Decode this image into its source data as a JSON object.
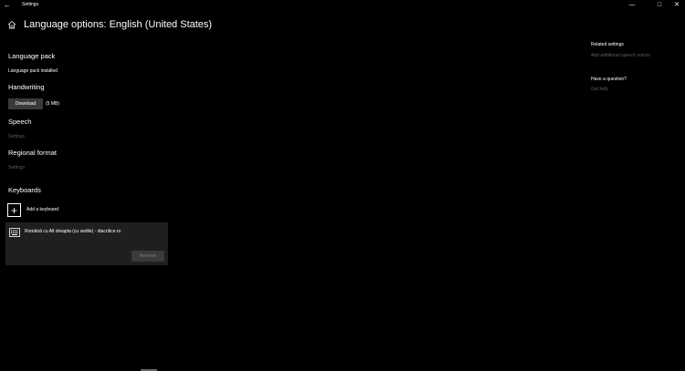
{
  "window": {
    "title": "Settings",
    "back_glyph": "←",
    "minimize_glyph": "—",
    "maximize_glyph": "□",
    "close_glyph": "✕"
  },
  "header": {
    "title": "Language options: English (United States)",
    "home_icon": "home-icon"
  },
  "sections": {
    "language_pack": {
      "heading": "Language pack",
      "status": "Language pack installed"
    },
    "handwriting": {
      "heading": "Handwriting",
      "download_label": "Download",
      "size": "(5 MB)"
    },
    "speech": {
      "heading": "Speech",
      "link": "Settings"
    },
    "regional_format": {
      "heading": "Regional format",
      "link": "Settings"
    },
    "keyboards": {
      "heading": "Keyboards",
      "add_label": "Add a keyboard",
      "add_glyph": "+",
      "items": [
        {
          "name": "Română cu Alt dreapta (cu sedile) - diacritice.ro",
          "remove_label": "Remove",
          "icon": "keyboard-icon"
        }
      ]
    }
  },
  "sidebar": {
    "related_heading": "Related settings",
    "related_link": "Add additional speech voices",
    "question_heading": "Have a question?",
    "question_link": "Get help"
  }
}
